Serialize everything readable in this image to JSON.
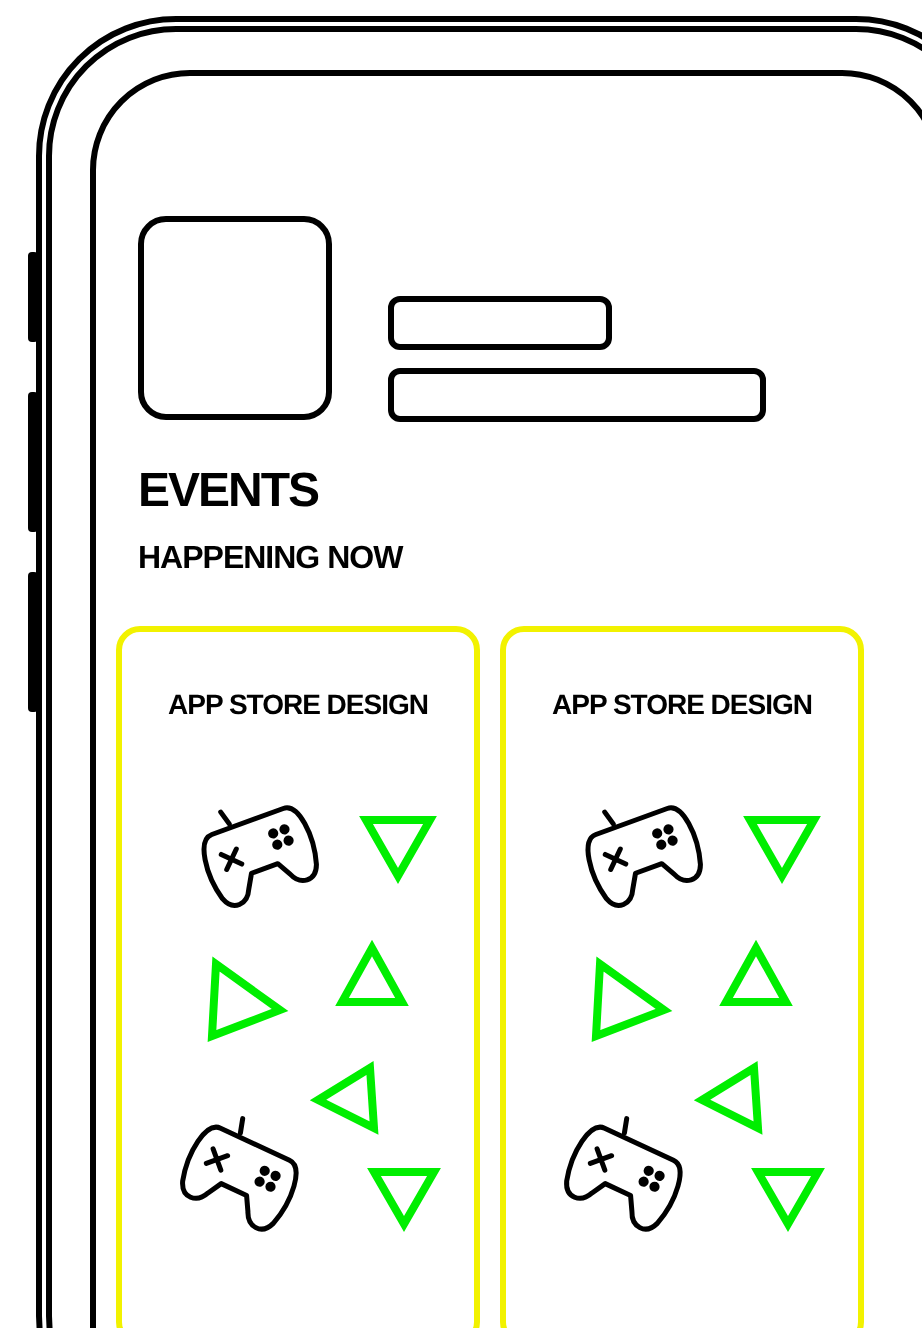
{
  "title": "EVENTS",
  "subtitle": "HAPPENING NOW",
  "cards": [
    {
      "title": "APP STORE DESIGN"
    },
    {
      "title": "APP STORE DESIGN"
    }
  ]
}
